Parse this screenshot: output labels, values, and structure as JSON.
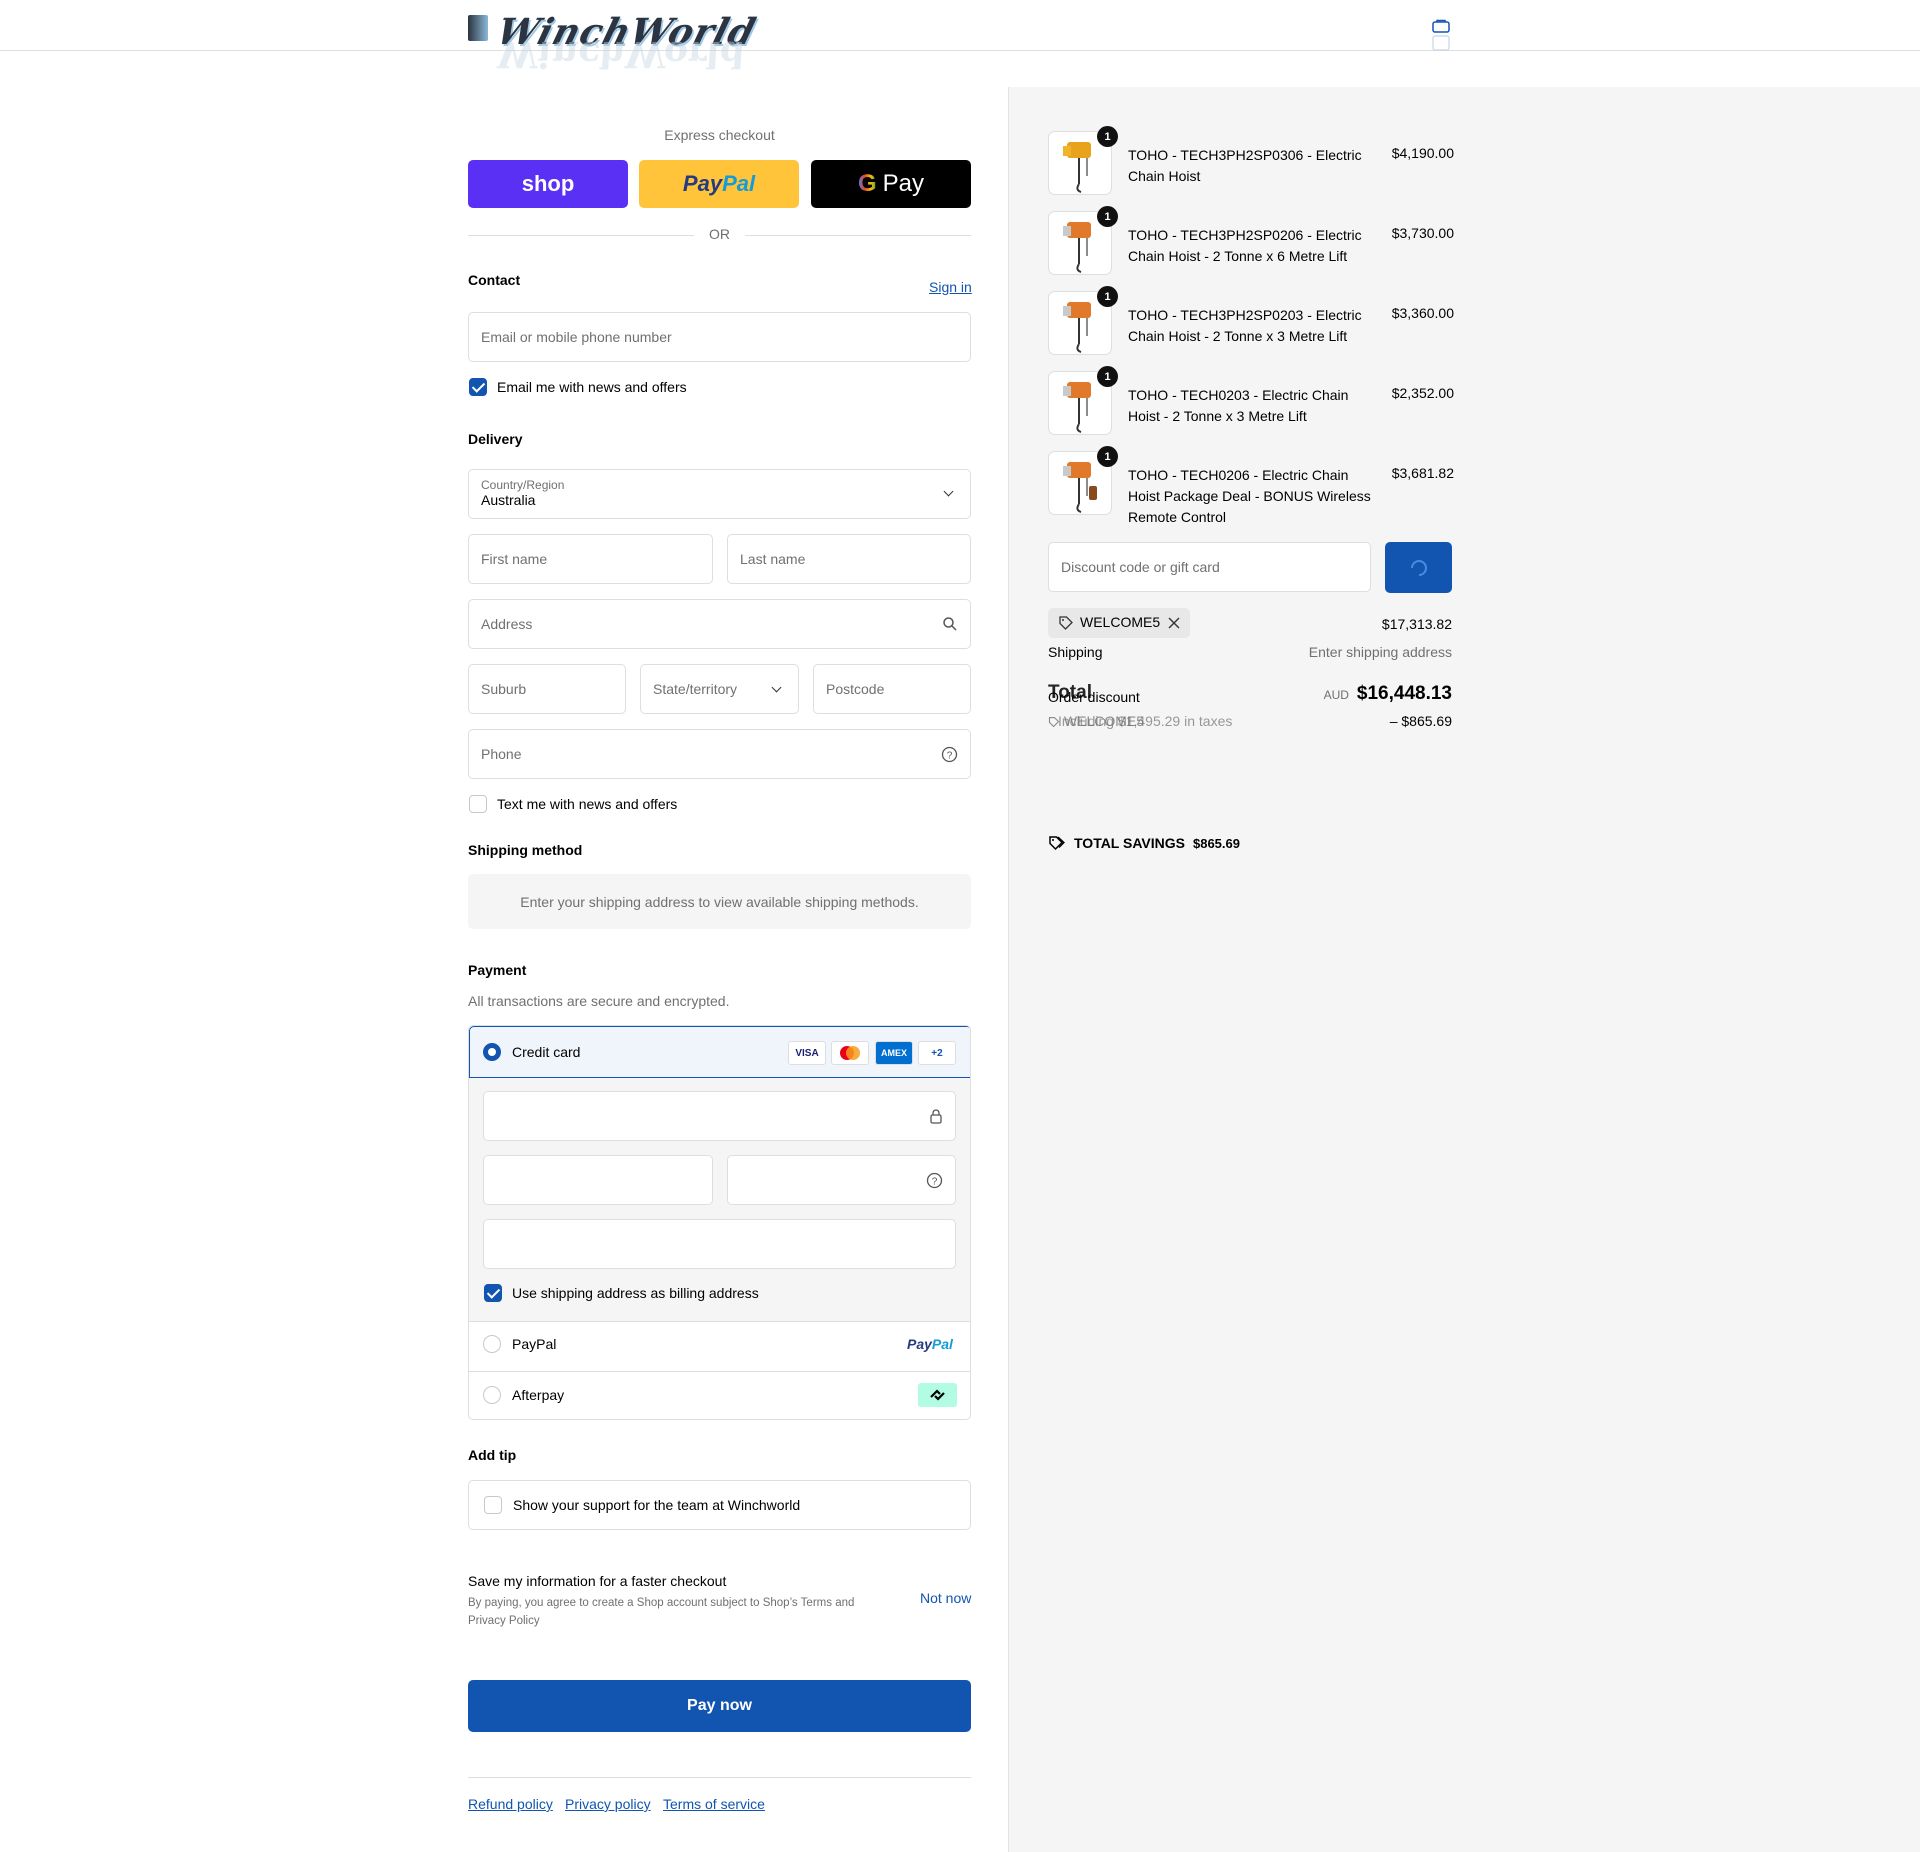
{
  "header": {
    "logo_text": "WinchWorld",
    "cart_icon": "shopping-bag-icon"
  },
  "express": {
    "label": "Express checkout",
    "shop": "shop",
    "paypal_a": "Pay",
    "paypal_b": "Pal",
    "gpay": "Pay",
    "or": "OR"
  },
  "contact": {
    "title": "Contact",
    "sign_in": "Sign in",
    "email_placeholder": "Email or mobile phone number",
    "news_label": "Email me with news and offers"
  },
  "delivery": {
    "title": "Delivery",
    "country_label": "Country/Region",
    "country_value": "Australia",
    "first_name": "First name",
    "last_name": "Last name",
    "address": "Address",
    "suburb": "Suburb",
    "state": "State/territory",
    "postcode": "Postcode",
    "phone": "Phone",
    "text_label": "Text me with news and offers"
  },
  "shipping": {
    "title": "Shipping method",
    "message": "Enter your shipping address to view available shipping methods."
  },
  "payment": {
    "title": "Payment",
    "subtitle": "All transactions are secure and encrypted.",
    "credit_card": "Credit card",
    "cards": [
      "VISA",
      "",
      "AMEX",
      "+2"
    ],
    "billing_label": "Use shipping address as billing address",
    "paypal": "PayPal",
    "paypal_logo_a": "Pay",
    "paypal_logo_b": "Pal",
    "afterpay": "Afterpay"
  },
  "tip": {
    "title": "Add tip",
    "label": "Show your support for the team at Winchworld"
  },
  "save": {
    "title": "Save my information for a faster checkout",
    "text_a": "By paying, you agree to create a Shop account subject to Shop’s",
    "terms": "Terms",
    "and": "and",
    "privacy": "Privacy Policy",
    "not_now": "Not now"
  },
  "pay_now": "Pay now",
  "footer": {
    "refund": "Refund policy",
    "privacy": "Privacy policy",
    "terms": "Terms of service"
  },
  "products": [
    {
      "qty": "1",
      "name": "TOHO - TECH3PH2SP0306 - Electric Chain Hoist",
      "price": "$4,190.00"
    },
    {
      "qty": "1",
      "name": "TOHO - TECH3PH2SP0206 - Electric Chain Hoist - 2 Tonne x 6 Metre Lift",
      "price": "$3,730.00"
    },
    {
      "qty": "1",
      "name": "TOHO - TECH3PH2SP0203 - Electric Chain Hoist - 2 Tonne x 3 Metre Lift",
      "price": "$3,360.00"
    },
    {
      "qty": "1",
      "name": "TOHO - TECH0203 - Electric Chain Hoist - 2 Tonne x 3 Metre Lift",
      "price": "$2,352.00"
    },
    {
      "qty": "1",
      "name": "TOHO - TECH0206 - Electric Chain Hoist Package Deal - BONUS Wireless Remote Control",
      "price": "$3,681.82"
    }
  ],
  "summary": {
    "discount_placeholder": "Discount code or gift card",
    "code": "WELCOME5",
    "subtotal": "$17,313.82",
    "shipping_label": "Shipping",
    "shipping_value": "Enter shipping address",
    "order_discount": "Order discount",
    "discount_code": "WELCOME5",
    "discount_value": "– $865.69",
    "total_label": "Total",
    "currency": "AUD",
    "total": "$16,448.13",
    "taxes": "Including $1,495.29 in taxes",
    "savings_label": "TOTAL SAVINGS",
    "savings_value": "$865.69"
  },
  "colors": {
    "primary": "#1155b0",
    "shop": "#5a31f4",
    "paypal": "#ffc439",
    "gpay": "#000000"
  }
}
